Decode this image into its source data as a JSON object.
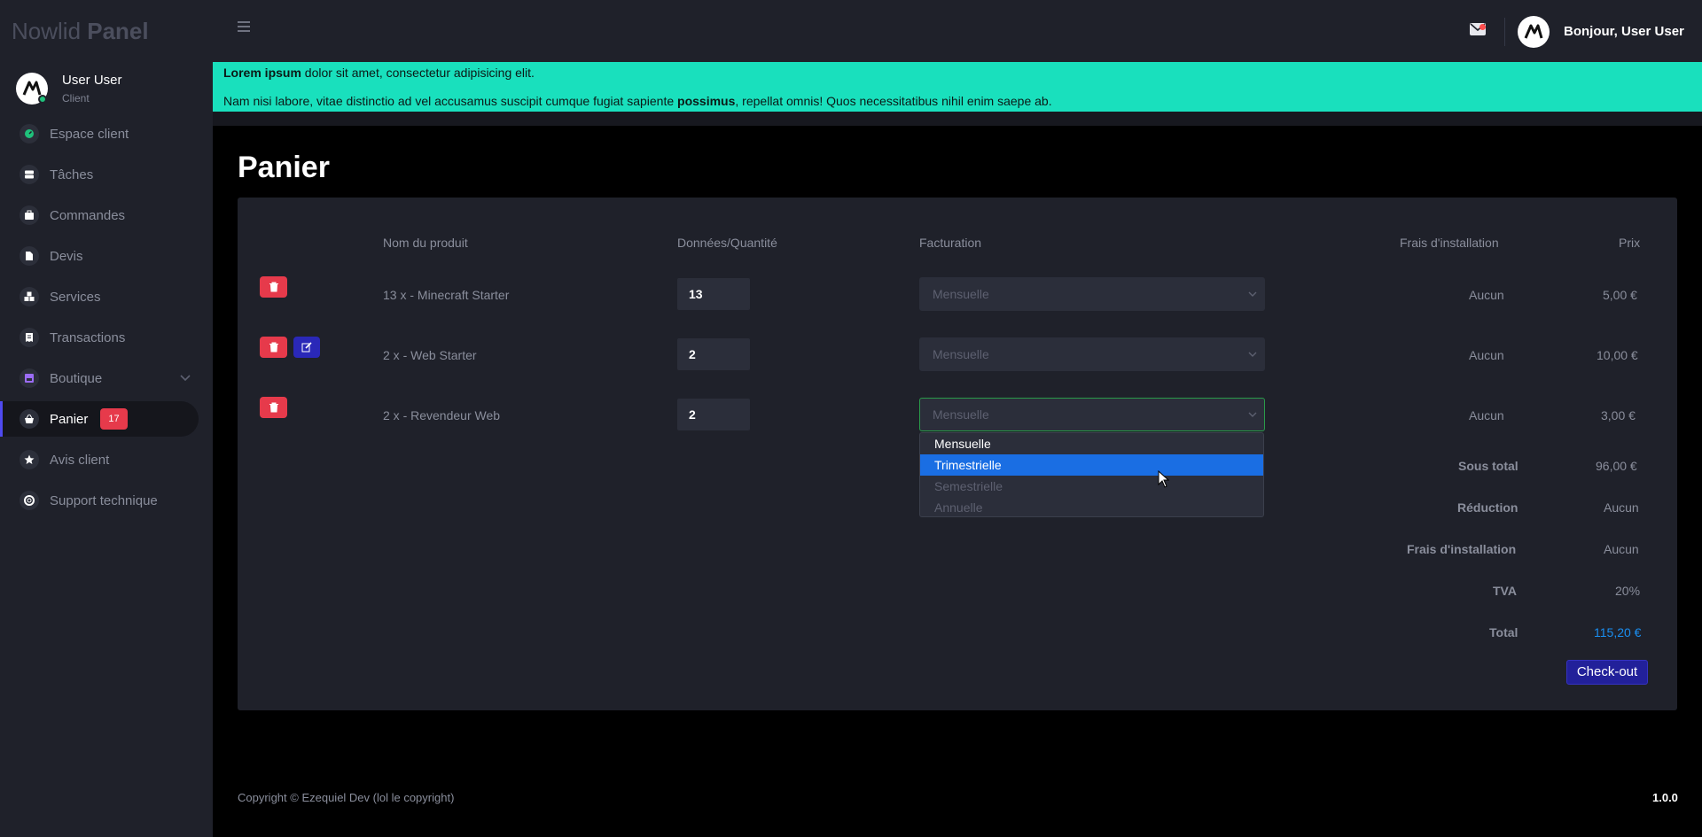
{
  "brand": {
    "part1": "Nowlid ",
    "part2": "Panel"
  },
  "user": {
    "name": "User User",
    "role": "Client"
  },
  "sidebar": {
    "items": [
      {
        "label": "Espace client"
      },
      {
        "label": "Tâches"
      },
      {
        "label": "Commandes"
      },
      {
        "label": "Devis"
      },
      {
        "label": "Services"
      },
      {
        "label": "Transactions"
      },
      {
        "label": "Boutique"
      },
      {
        "label": "Panier",
        "badge": "17"
      },
      {
        "label": "Avis client"
      },
      {
        "label": "Support technique"
      }
    ]
  },
  "topbar": {
    "greeting": "Bonjour, User User"
  },
  "notice": {
    "l1_bold": "Lorem ipsum",
    "l1_rest": " dolor sit amet, consectetur adipisicing elit.",
    "l2_start": "Nam nisi labore, vitae distinctio ad vel accusamus suscipit cumque fugiat sapiente ",
    "l2_bold": "possimus",
    "l2_end": ", repellat omnis! Quos necessitatibus nihil enim saepe ab."
  },
  "page": {
    "title": "Panier"
  },
  "cart": {
    "headers": {
      "product": "Nom du produit",
      "quantity": "Données/Quantité",
      "billing": "Facturation",
      "setup": "Frais d'installation",
      "price": "Prix"
    },
    "rows": [
      {
        "product": "13 x - Minecraft Starter",
        "quantity": "13",
        "billing": "Mensuelle",
        "setup": "Aucun",
        "price": "5,00 €"
      },
      {
        "product": "2 x - Web Starter",
        "quantity": "2",
        "billing": "Mensuelle",
        "setup": "Aucun",
        "price": "10,00 €"
      },
      {
        "product": "2 x - Revendeur Web",
        "quantity": "2",
        "billing": "Mensuelle",
        "setup": "Aucun",
        "price": "3,00 €"
      }
    ],
    "dropdown_options": [
      "Mensuelle",
      "Trimestrielle",
      "Semestrielle",
      "Annuelle"
    ],
    "summary": {
      "subtotal_label": "Sous total",
      "subtotal": "96,00 €",
      "discount_label": "Réduction",
      "discount": "Aucun",
      "setup_label": "Frais d'installation",
      "setup": "Aucun",
      "tax_label": "TVA",
      "tax": "20%",
      "total_label": "Total",
      "total": "115,20 €"
    },
    "checkout_label": "Check-out"
  },
  "footer": {
    "copyright": "Copyright © Ezequiel Dev (lol le copyright)",
    "version": "1.0.0"
  },
  "colors": {
    "accent_teal": "#19e0bd",
    "danger": "#e63a4b",
    "primary": "#22209a",
    "link_blue": "#1a8ef0"
  }
}
